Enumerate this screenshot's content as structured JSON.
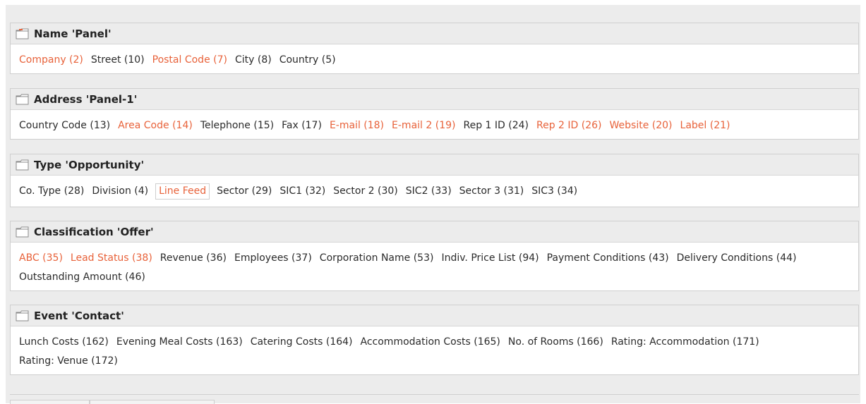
{
  "panels": [
    {
      "title": "Name 'Panel'",
      "icon": "open-panel-icon",
      "fields": [
        {
          "label": "Company (2)",
          "style": "highlight"
        },
        {
          "label": "Street (10)",
          "style": "normal"
        },
        {
          "label": "Postal Code (7)",
          "style": "highlight"
        },
        {
          "label": "City (8)",
          "style": "normal"
        },
        {
          "label": "Country (5)",
          "style": "normal"
        }
      ]
    },
    {
      "title": "Address 'Panel-1'",
      "icon": "folder-icon",
      "fields": [
        {
          "label": "Country Code (13)",
          "style": "normal"
        },
        {
          "label": "Area Code (14)",
          "style": "highlight"
        },
        {
          "label": "Telephone (15)",
          "style": "normal"
        },
        {
          "label": "Fax (17)",
          "style": "normal"
        },
        {
          "label": "E-mail (18)",
          "style": "highlight"
        },
        {
          "label": "E-mail 2 (19)",
          "style": "highlight"
        },
        {
          "label": "Rep 1 ID (24)",
          "style": "normal"
        },
        {
          "label": "Rep 2 ID (26)",
          "style": "highlight"
        },
        {
          "label": "Website (20)",
          "style": "highlight"
        },
        {
          "label": "Label (21)",
          "style": "highlight"
        }
      ]
    },
    {
      "title": "Type 'Opportunity'",
      "icon": "folder-icon",
      "fields": [
        {
          "label": "Co. Type (28)",
          "style": "normal"
        },
        {
          "label": "Division (4)",
          "style": "normal"
        },
        {
          "label": "Line Feed",
          "style": "boxed"
        },
        {
          "label": "Sector (29)",
          "style": "normal"
        },
        {
          "label": "SIC1 (32)",
          "style": "normal"
        },
        {
          "label": "Sector 2 (30)",
          "style": "normal"
        },
        {
          "label": "SIC2 (33)",
          "style": "normal"
        },
        {
          "label": "Sector 3 (31)",
          "style": "normal"
        },
        {
          "label": "SIC3 (34)",
          "style": "normal"
        }
      ]
    },
    {
      "title": "Classification 'Offer'",
      "icon": "folder-icon",
      "fields": [
        {
          "label": "ABC (35)",
          "style": "highlight"
        },
        {
          "label": "Lead Status (38)",
          "style": "highlight"
        },
        {
          "label": "Revenue (36)",
          "style": "normal"
        },
        {
          "label": "Employees (37)",
          "style": "normal"
        },
        {
          "label": "Corporation Name (53)",
          "style": "normal"
        },
        {
          "label": "Indiv. Price List (94)",
          "style": "normal"
        },
        {
          "label": "Payment Conditions (43)",
          "style": "normal"
        },
        {
          "label": "Delivery Conditions (44)",
          "style": "normal"
        },
        {
          "label": "Outstanding Amount (46)",
          "style": "normal"
        }
      ]
    },
    {
      "title": "Event 'Contact'",
      "icon": "folder-icon",
      "fields": [
        {
          "label": "Lunch Costs (162)",
          "style": "normal"
        },
        {
          "label": "Evening Meal Costs (163)",
          "style": "normal"
        },
        {
          "label": "Catering Costs (164)",
          "style": "normal"
        },
        {
          "label": "Accommodation Costs (165)",
          "style": "normal"
        },
        {
          "label": "No. of Rooms (166)",
          "style": "normal"
        },
        {
          "label": "Rating: Accommodation (171)",
          "style": "normal"
        },
        {
          "label": "Rating: Venue (172)",
          "style": "normal"
        }
      ]
    }
  ],
  "colors": {
    "highlight": "#e8623a",
    "text": "#2b2b2b",
    "header_bg": "#ececec",
    "border": "#cfcfcf"
  }
}
